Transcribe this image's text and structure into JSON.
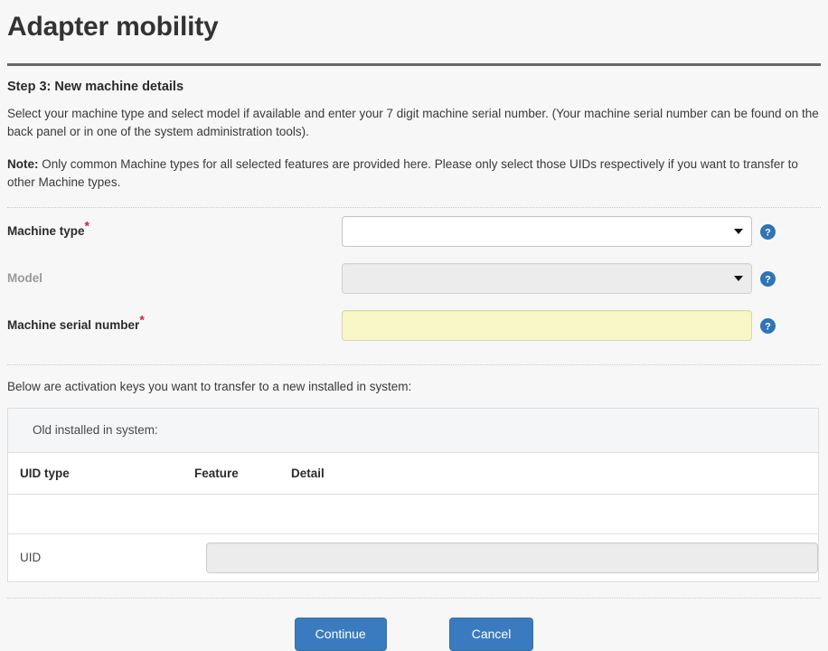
{
  "page": {
    "title": "Adapter mobility",
    "step_heading": "Step 3: New machine details",
    "intro": "Select your machine type and select model if available and enter your 7 digit machine serial number. (Your machine serial number can be found on the back panel or in one of the system administration tools).",
    "note_label": "Note:",
    "note_text": " Only common Machine types for all selected features are provided here. Please only select those UIDs respectively if you want to transfer to other Machine types."
  },
  "form": {
    "machine_type": {
      "label": "Machine type",
      "required_marker": "*",
      "value": "",
      "icon": "help-icon"
    },
    "model": {
      "label": "Model",
      "value": "",
      "icon": "help-icon",
      "disabled": true
    },
    "machine_serial_number": {
      "label": "Machine serial number",
      "required_marker": "*",
      "value": "",
      "placeholder": "",
      "icon": "help-icon"
    }
  },
  "transfer_section": {
    "intro": "Below are activation keys you want to transfer to a new installed in system:",
    "table": {
      "caption": "Old installed in system:",
      "columns": [
        "UID type",
        "Feature",
        "Detail"
      ],
      "rows": [],
      "uid_row": {
        "label": "UID",
        "value": "",
        "disabled": true
      }
    }
  },
  "actions": {
    "continue_label": "Continue",
    "cancel_label": "Cancel"
  },
  "colors": {
    "accent_button": "#3a7bbf",
    "required_star": "#cc2244",
    "help_icon": "#2f74b5",
    "input_highlight": "#f7f7c8",
    "page_background": "#f7f7f7"
  }
}
